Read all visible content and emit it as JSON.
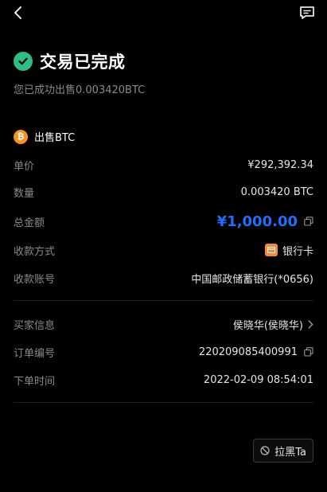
{
  "header": {
    "back_icon": "chevron-left-icon",
    "message_icon": "message-icon"
  },
  "status": {
    "icon": "check-circle-icon",
    "title": "交易已完成",
    "subtitle": "您已成功出售0.003420BTC"
  },
  "asset": {
    "icon": "btc-coin-icon",
    "icon_glyph": "₿",
    "title": "出售BTC"
  },
  "details": {
    "unit_price_label": "单价",
    "unit_price_value": "¥292,392.34",
    "quantity_label": "数量",
    "quantity_value": "0.003420 BTC",
    "total_label": "总金额",
    "total_value": "¥1,000.00",
    "payment_method_label": "收款方式",
    "payment_method_value": "银行卡",
    "account_label": "收款账号",
    "account_value": "中国邮政储蓄银行(*0656)"
  },
  "order": {
    "buyer_label": "买家信息",
    "buyer_value": "侯晓华(侯晓华)",
    "order_id_label": "订单编号",
    "order_id_value": "220209085400991",
    "order_time_label": "下单时间",
    "order_time_value": "2022-02-09 08:54:01"
  },
  "actions": {
    "block_label": "拉黑Ta"
  },
  "colors": {
    "background": "#000000",
    "success": "#2ebd85",
    "accent_blue": "#1f6fff",
    "btc_orange": "#f7931a",
    "bank_orange": "#f08a3c",
    "muted_text": "#8a8a8a"
  }
}
